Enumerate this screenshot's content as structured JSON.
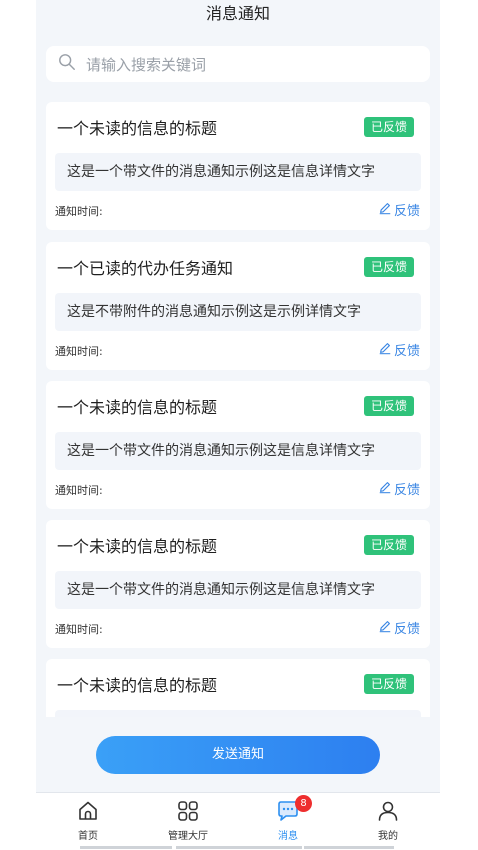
{
  "header": {
    "title": "消息通知"
  },
  "search": {
    "placeholder": "请输入搜索关键词"
  },
  "notifications": [
    {
      "title": "一个未读的信息的标题",
      "badge": "已反馈",
      "body": "这是一个带文件的消息通知示例这是信息详情文字",
      "time_label": "通知时间:",
      "feedback_label": "反馈"
    },
    {
      "title": "一个已读的代办任务通知",
      "badge": "已反馈",
      "body": "这是不带附件的消息通知示例这是示例详情文字",
      "time_label": "通知时间:",
      "feedback_label": "反馈"
    },
    {
      "title": "一个未读的信息的标题",
      "badge": "已反馈",
      "body": "这是一个带文件的消息通知示例这是信息详情文字",
      "time_label": "通知时间:",
      "feedback_label": "反馈"
    },
    {
      "title": "一个未读的信息的标题",
      "badge": "已反馈",
      "body": "这是一个带文件的消息通知示例这是信息详情文字",
      "time_label": "通知时间:",
      "feedback_label": "反馈"
    },
    {
      "title": "一个未读的信息的标题",
      "badge": "已反馈",
      "body": "",
      "time_label": "",
      "feedback_label": ""
    }
  ],
  "send_button": {
    "label": "发送通知"
  },
  "tabbar": {
    "items": [
      {
        "label": "首页",
        "icon": "home-icon"
      },
      {
        "label": "管理大厅",
        "icon": "grid-icon"
      },
      {
        "label": "消息",
        "icon": "message-icon",
        "badge": "8",
        "active": true
      },
      {
        "label": "我的",
        "icon": "user-icon"
      }
    ]
  },
  "colors": {
    "accent": "#2d8ff0",
    "badge_green": "#2fc27a",
    "badge_red": "#ee2e2e",
    "page_bg": "#f3f6fa"
  }
}
